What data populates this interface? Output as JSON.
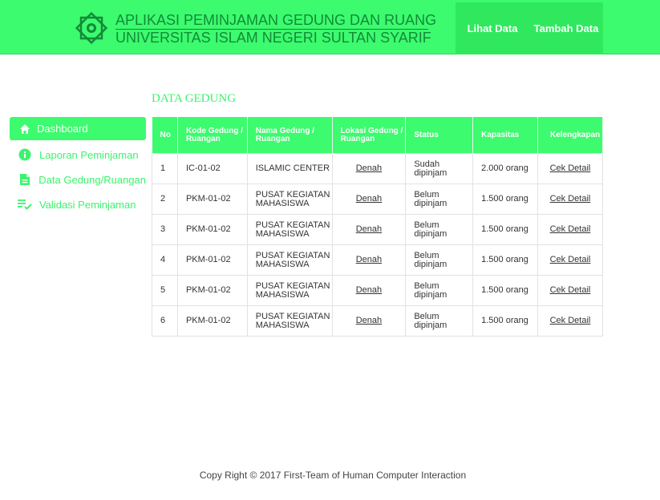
{
  "header": {
    "title_line1": "APLIKASI PEMINJAMAN GEDUNG DAN RUANGAN",
    "title_line2": "UNIVERSITAS ISLAM NEGERI SULTAN SYARIF KASIM",
    "nav": [
      "Lihat Data",
      "Tambah Data"
    ],
    "color": "#3cfb6e"
  },
  "sidebar": {
    "items": [
      {
        "label": "Dashboard",
        "icon": "home-icon",
        "active": true
      },
      {
        "label": "Laporan Peminjaman",
        "icon": "info-icon"
      },
      {
        "label": "Data Gedung/Ruangan",
        "icon": "document-icon"
      },
      {
        "label": "Validasi Peminjaman",
        "icon": "checklist-icon"
      }
    ]
  },
  "main": {
    "section_title": "DATA GEDUNG",
    "columns": [
      "No",
      "Kode Gedung / Ruangan",
      "Nama Gedung / Ruangan",
      "Lokasi Gedung / Ruangan",
      "Status",
      "Kapasitas",
      "Kelengkapan"
    ],
    "rows": [
      {
        "no": "1",
        "kode": "IC-01-02",
        "nama": "ISLAMIC CENTER",
        "lokasi": "Denah",
        "status": "Sudah dipinjam",
        "kapasitas": "2.000 orang",
        "kelengkapan": "Cek Detail"
      },
      {
        "no": "2",
        "kode": "PKM-01-02",
        "nama": "PUSAT KEGIATAN MAHASISWA",
        "lokasi": "Denah",
        "status": "Belum dipinjam",
        "kapasitas": "1.500 orang",
        "kelengkapan": "Cek Detail"
      },
      {
        "no": "3",
        "kode": "PKM-01-02",
        "nama": "PUSAT KEGIATAN MAHASISWA",
        "lokasi": "Denah",
        "status": "Belum dipinjam",
        "kapasitas": "1.500 orang",
        "kelengkapan": "Cek Detail"
      },
      {
        "no": "4",
        "kode": "PKM-01-02",
        "nama": "PUSAT KEGIATAN MAHASISWA",
        "lokasi": "Denah",
        "status": "Belum dipinjam",
        "kapasitas": "1.500 orang",
        "kelengkapan": "Cek Detail"
      },
      {
        "no": "5",
        "kode": "PKM-01-02",
        "nama": "PUSAT KEGIATAN MAHASISWA",
        "lokasi": "Denah",
        "status": "Belum dipinjam",
        "kapasitas": "1.500 orang",
        "kelengkapan": "Cek Detail"
      },
      {
        "no": "6",
        "kode": "PKM-01-02",
        "nama": "PUSAT KEGIATAN MAHASISWA",
        "lokasi": "Denah",
        "status": "Belum dipinjam",
        "kapasitas": "1.500 orang",
        "kelengkapan": "Cek Detail"
      }
    ]
  },
  "footer": {
    "text": "Copy Right © 2017 First-Team of Human Computer Interaction"
  }
}
